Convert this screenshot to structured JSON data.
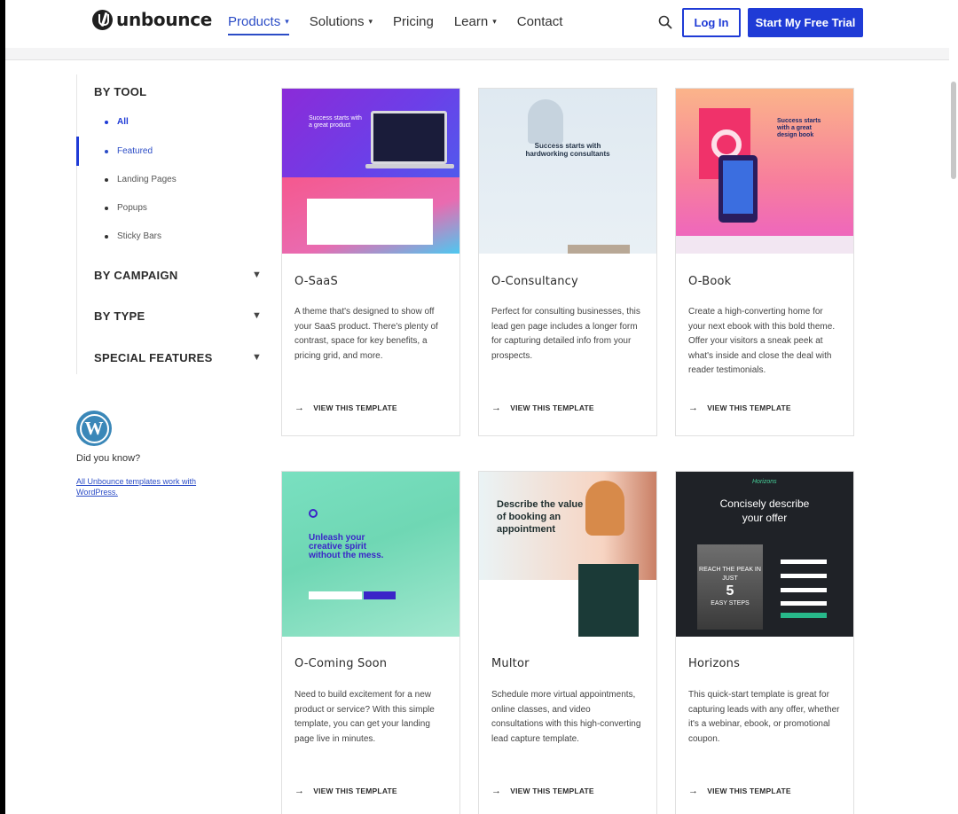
{
  "header": {
    "logo_text": "unbounce",
    "nav": [
      {
        "label": "Products",
        "chevron": "⌄",
        "active": true
      },
      {
        "label": "Solutions",
        "chevron": "⌄"
      },
      {
        "label": "Pricing"
      },
      {
        "label": "Learn",
        "chevron": "⌄"
      },
      {
        "label": "Contact"
      }
    ],
    "search_icon": "search-icon",
    "login_label": "Log In",
    "trial_label": "Start My Free Trial"
  },
  "sidebar": {
    "by_tool": "BY TOOL",
    "tool_items": [
      "All",
      "Featured",
      "Landing Pages",
      "Popups",
      "Sticky Bars"
    ],
    "selected_tool": "All",
    "by_campaign": "BY CAMPAIGN",
    "by_type": "BY TYPE",
    "special_features": "SPECIAL FEATURES",
    "did_you_know": "Did you know?",
    "wp_link": "All Unbounce templates work with WordPress."
  },
  "cards": [
    {
      "title": "O-SaaS",
      "description": "A theme that's designed to show off your SaaS product. There's plenty of contrast, space for key benefits, a pricing grid, and more.",
      "cta": "VIEW THIS TEMPLATE",
      "thumb_text": "Success starts with a great product"
    },
    {
      "title": "O-Consultancy",
      "description": "Perfect for consulting businesses, this lead gen page includes a longer form for capturing detailed info from your prospects.",
      "cta": "VIEW THIS TEMPLATE",
      "thumb_text": "Success starts with hardworking consultants"
    },
    {
      "title": "O-Book",
      "description": "Create a high-converting home for your next ebook with this bold theme. Offer your visitors a sneak peek at what's inside and close the deal with reader testimonials.",
      "cta": "VIEW THIS TEMPLATE",
      "thumb_text": "Success starts with a great design book"
    },
    {
      "title": "O-Coming Soon",
      "description": "Need to build excitement for a new product or service? With this simple template, you can get your landing page live in minutes.",
      "cta": "VIEW THIS TEMPLATE",
      "thumb_text": "Unleash your creative spirit without the mess."
    },
    {
      "title": "Multor",
      "description": "Schedule more virtual appointments, online classes, and video consultations with this high-converting lead capture template.",
      "cta": "VIEW THIS TEMPLATE",
      "thumb_text": "Describe the value of booking an appointment"
    },
    {
      "title": "Horizons",
      "description": "This quick-start template is great for capturing leads with any offer, whether it's a webinar, ebook, or promotional coupon.",
      "cta": "VIEW THIS TEMPLATE",
      "thumb_text": "Concisely describe your offer",
      "poster_text": "REACH THE PEAK IN JUST",
      "poster_num": "5",
      "poster_sub": "EASY STEPS",
      "brand": "Horizons"
    }
  ],
  "colors": {
    "accent": "#1f3bd6",
    "link": "#2b4cc6"
  }
}
